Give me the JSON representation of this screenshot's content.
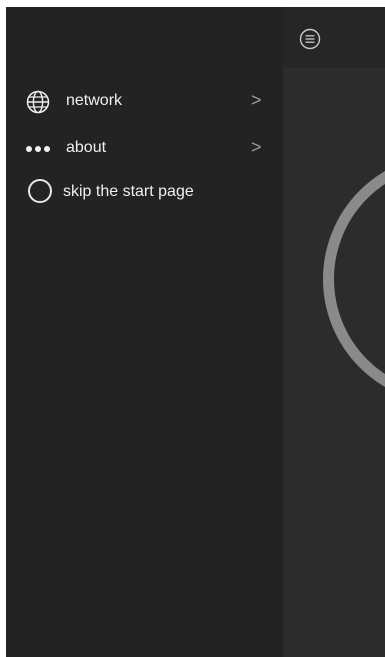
{
  "drawer": {
    "items": [
      {
        "label": "network",
        "icon": "globe-icon",
        "has_chevron": true,
        "chevron": ">"
      },
      {
        "label": "about",
        "icon": "more-dots-icon",
        "has_chevron": true,
        "chevron": ">"
      },
      {
        "label": "skip the start page",
        "icon": "radio-unchecked",
        "checked": false
      }
    ]
  },
  "toolbar": {
    "menu_icon": "menu-icon"
  },
  "colors": {
    "background": "#232323",
    "main_panel": "#2c2c2c",
    "ring": "#8a8a8a",
    "text": "#efefef"
  }
}
